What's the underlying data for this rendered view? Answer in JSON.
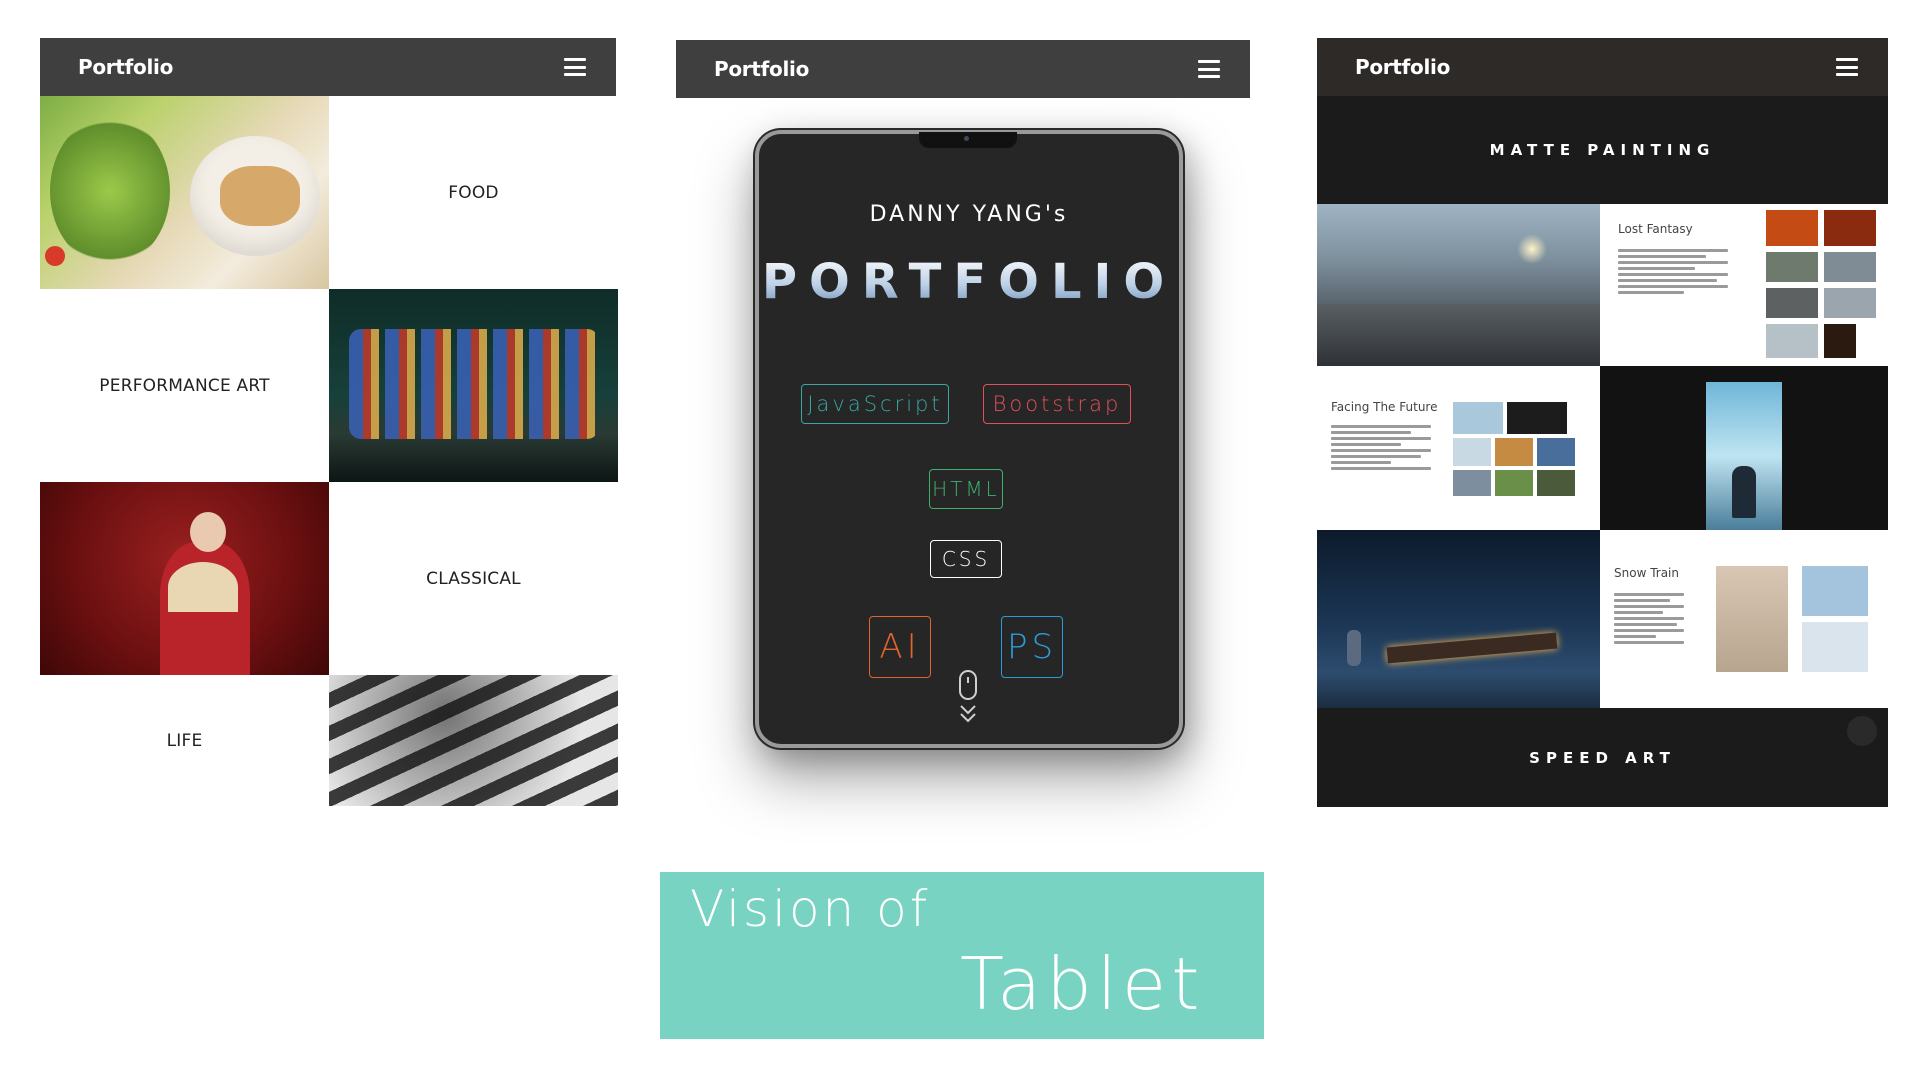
{
  "panel_left": {
    "brand": "Portfolio",
    "labels": {
      "food": "FOOD",
      "performance": "PERFORMANCE ART",
      "classical": "CLASSICAL",
      "life": "LIFE"
    }
  },
  "panel_center": {
    "brand": "Portfolio",
    "subtitle": "DANNY YANG's",
    "title": "PORTFOLIO",
    "skills": {
      "javascript": "JavaScript",
      "bootstrap": "Bootstrap",
      "html": "HTML",
      "css": "CSS",
      "ai": "AI",
      "ps": "PS"
    },
    "colors": {
      "javascript": "#3aa7a0",
      "bootstrap": "#e0505c",
      "html": "#3fb06a",
      "css": "#ffffff",
      "ai": "#e0642d",
      "ps": "#2f9bd6"
    }
  },
  "panel_right": {
    "brand": "Portfolio",
    "matte_heading": "MATTE PAINTING",
    "speed_heading": "SPEED ART",
    "works": {
      "lost": "Lost Fantasy",
      "future": "Facing The Future",
      "train": "Snow Train"
    }
  },
  "caption": {
    "line1": "Vision of",
    "line2": "Tablet"
  },
  "theme": {
    "nav_bg": "#3f3f3f",
    "caption_bg": "#79d3c2"
  }
}
